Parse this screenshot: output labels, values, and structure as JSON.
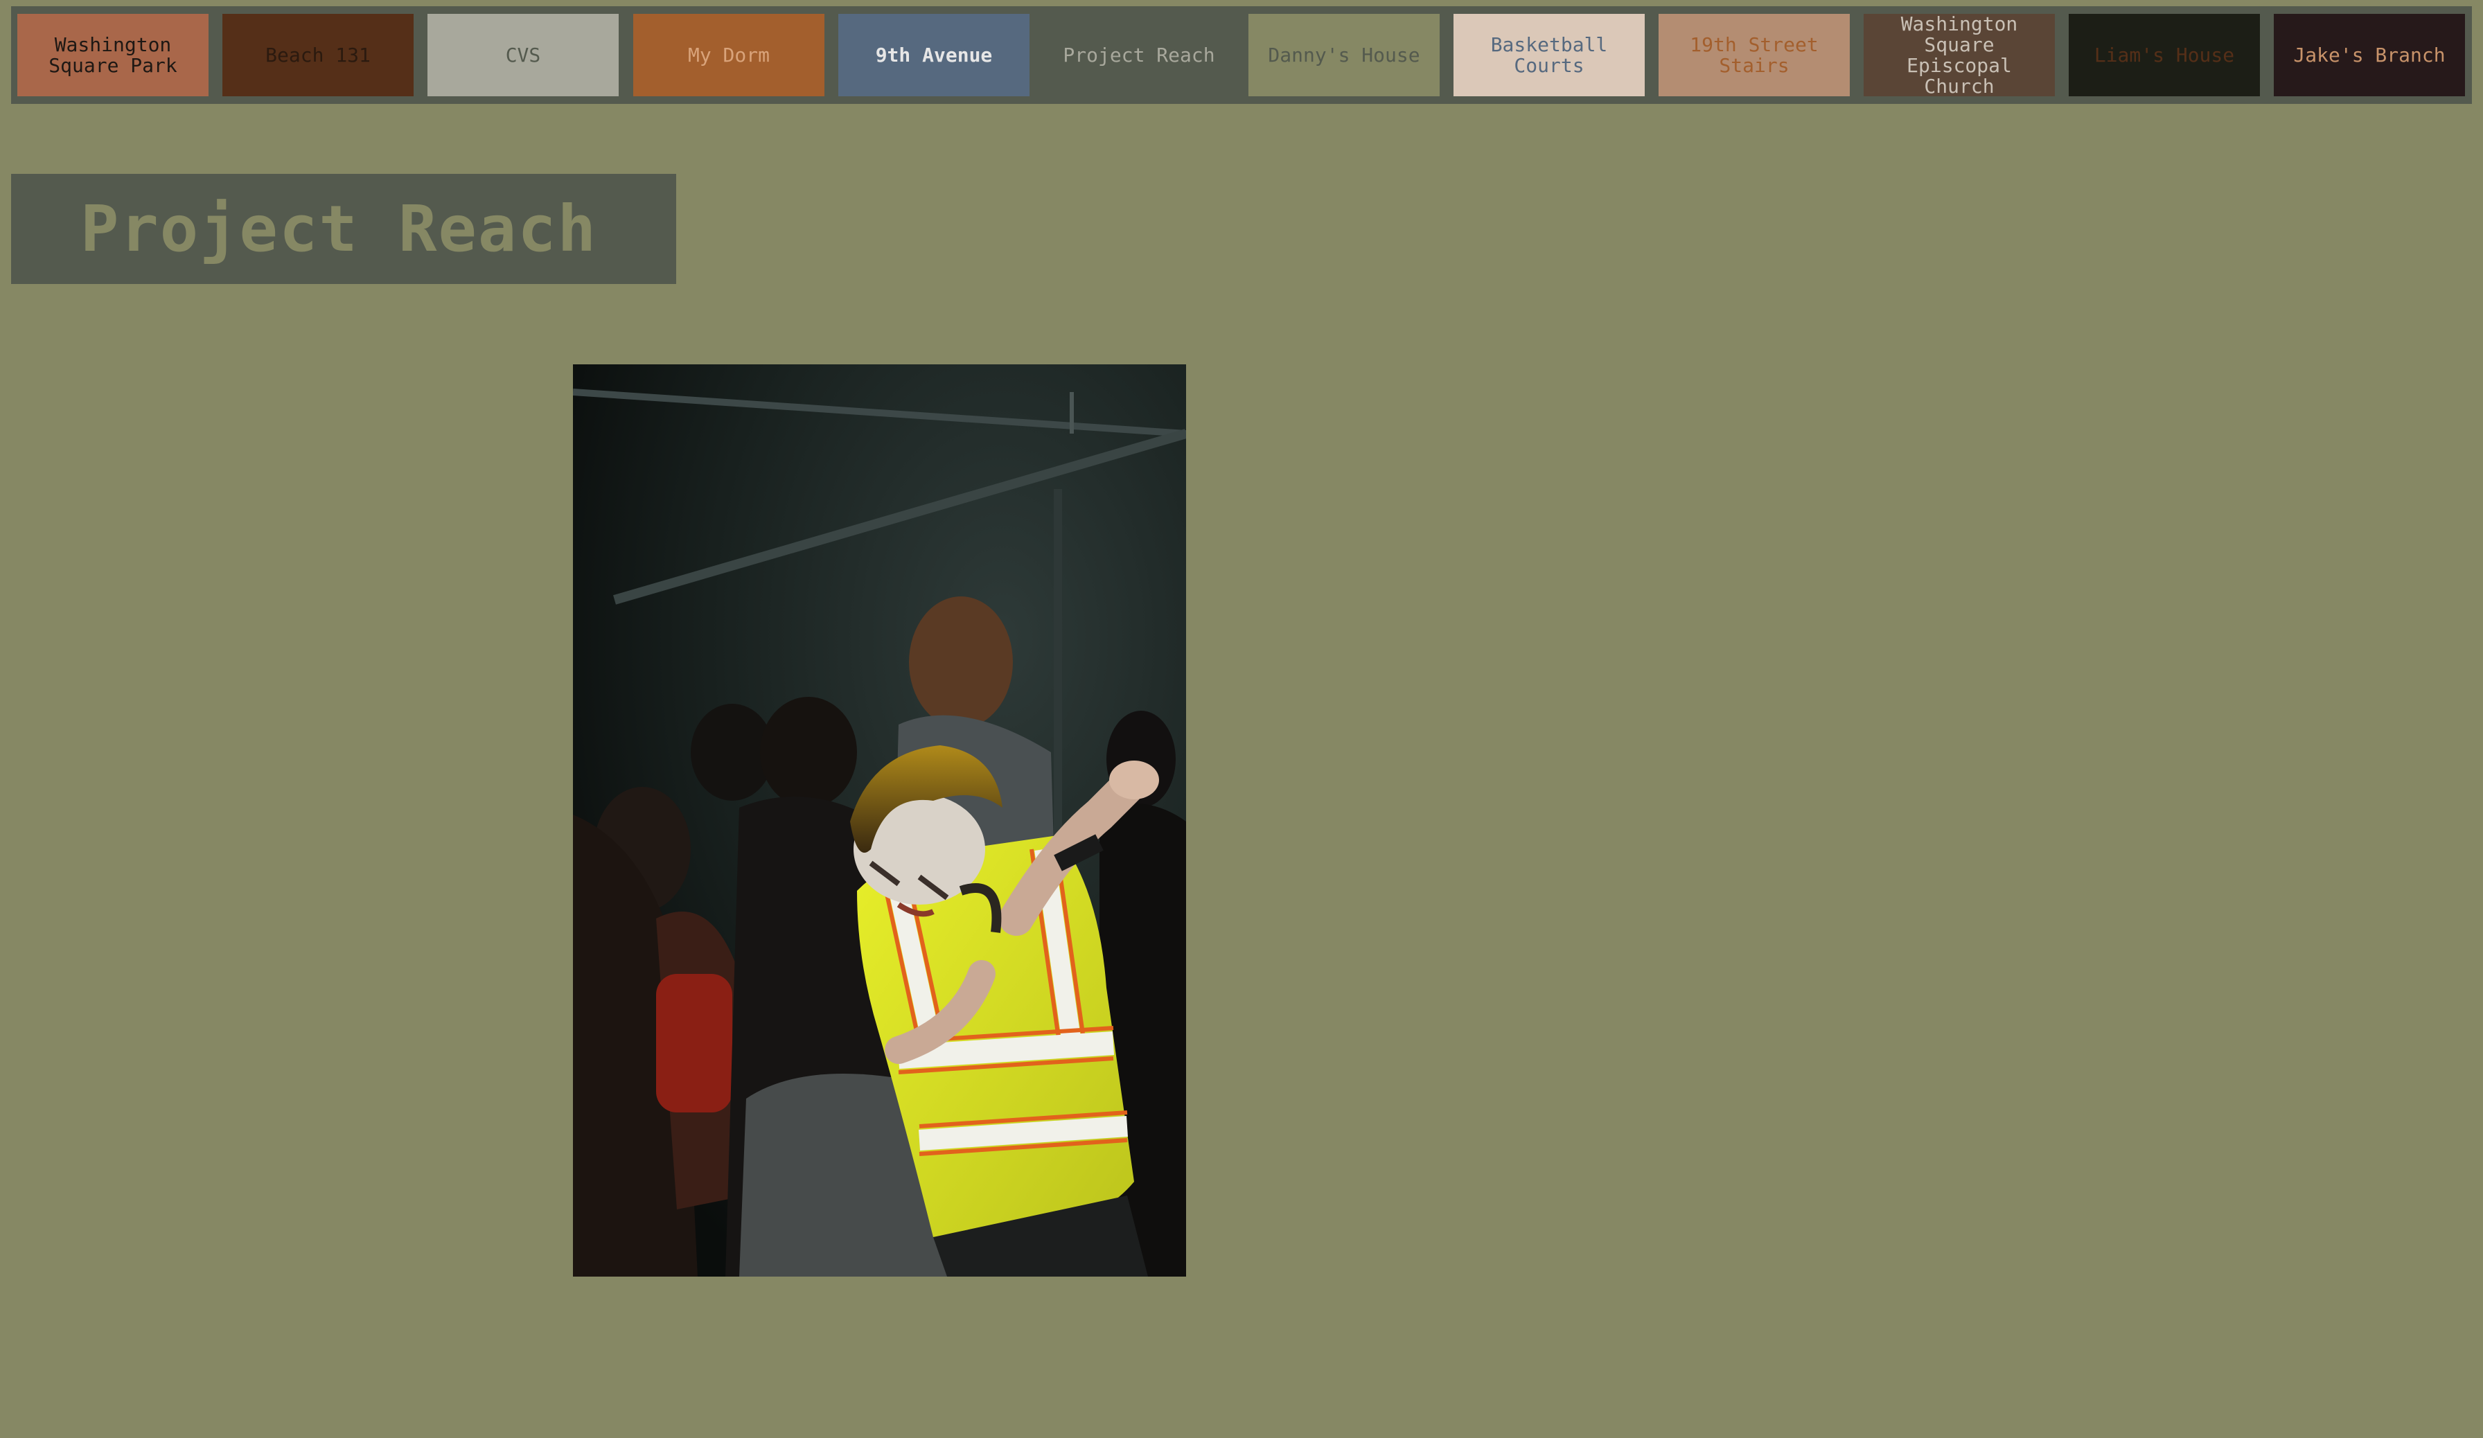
{
  "nav": {
    "items": [
      {
        "label": "Washington Square Park",
        "bg": "#a9674a",
        "color": "#1e1814"
      },
      {
        "label": "Beach 131",
        "bg": "#552f18",
        "color": "#2b1a0f"
      },
      {
        "label": "CVS",
        "bg": "#a8a89c",
        "color": "#545a4e"
      },
      {
        "label": "My Dorm",
        "bg": "#a35f2d",
        "color": "#d9a37a"
      },
      {
        "label": "9th Avenue",
        "bg": "#56697f",
        "color": "#e6e6e6"
      },
      {
        "label": "Project Reach",
        "bg": "#545a4e",
        "color": "#a8a89c"
      },
      {
        "label": "Danny's House",
        "bg": "#868864",
        "color": "#545a4e"
      },
      {
        "label": "Basketball Courts",
        "bg": "#dbc8b8",
        "color": "#56697f"
      },
      {
        "label": "19th Street Stairs",
        "bg": "#b48d72",
        "color": "#a35f2d"
      },
      {
        "label": "Washington Square Episcopal Church",
        "bg": "#5a4536",
        "color": "#c9c0b5"
      },
      {
        "label": "Liam's House",
        "bg": "#1c1e16",
        "color": "#552f18"
      },
      {
        "label": "Jake's Branch",
        "bg": "#26191a",
        "color": "#c8936a"
      }
    ]
  },
  "page": {
    "title": "Project Reach"
  },
  "photo": {
    "subject": "dancer-in-reflective-safety-vest"
  }
}
